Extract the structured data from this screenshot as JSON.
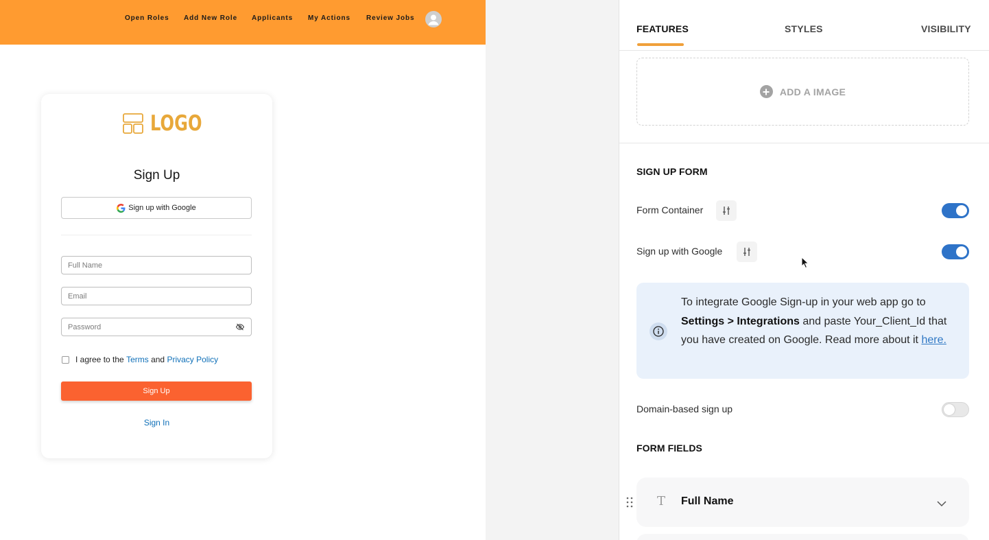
{
  "preview": {
    "nav": {
      "items": [
        "Open Roles",
        "Add New Role",
        "Applicants",
        "My Actions",
        "Review Jobs"
      ]
    },
    "card": {
      "logo_text": "LOGO",
      "title": "Sign Up",
      "google_button": "Sign up with Google",
      "fields": {
        "full_name_placeholder": "Full Name",
        "email_placeholder": "Email",
        "password_placeholder": "Password"
      },
      "agree": {
        "prefix": "I agree to the",
        "terms": "Terms",
        "and": "and",
        "privacy": "Privacy Policy"
      },
      "submit": "Sign Up",
      "signin": "Sign In"
    }
  },
  "panel": {
    "tabs": [
      "FEATURES",
      "STYLES",
      "VISIBILITY"
    ],
    "active_tab": "FEATURES",
    "add_image": "ADD A IMAGE",
    "signup_form": {
      "title": "SIGN UP FORM",
      "form_container": {
        "label": "Form Container",
        "enabled": true
      },
      "google": {
        "label": "Sign up with Google",
        "enabled": true
      },
      "info": {
        "line1": "To integrate Google Sign-up in your web app go to",
        "bold": "Settings > Integrations",
        "line2": "and paste Your_Client_Id that you have created on Google. Read more about it",
        "link": "here."
      },
      "domain": {
        "label": "Domain-based sign up",
        "enabled": false
      }
    },
    "form_fields": {
      "title": "FORM FIELDS",
      "items": [
        {
          "icon": "T",
          "label": "Full Name"
        }
      ]
    }
  },
  "colors": {
    "nav_bg": "#ff9b30",
    "logo": "#e8a83a",
    "primary_button": "#fb6230",
    "link": "#0e6fb8",
    "toggle_on": "#2e73c8",
    "tab_accent": "#f0a03a",
    "info_bg": "#e9f1fb"
  }
}
